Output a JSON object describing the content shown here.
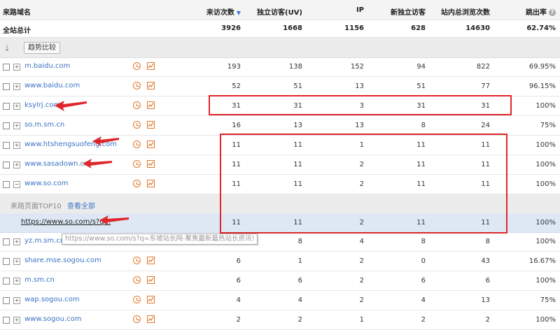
{
  "header": {
    "source_domain": "来路域名",
    "visits": "来访次数",
    "sort_arrow": "▼",
    "uv": "独立访客(UV)",
    "ip": "IP",
    "new_visitors": "新独立访客",
    "pageviews": "站内总浏览次数",
    "bounce_rate": "跳出率"
  },
  "total": {
    "label": "全站总计",
    "visits": "3926",
    "uv": "1668",
    "ip": "1156",
    "new_visitors": "628",
    "pageviews": "14630",
    "bounce_rate": "62.74%"
  },
  "trend_button": "趋势比较",
  "rows_top": [
    {
      "domain": "m.baidu.com",
      "expand": "+",
      "visits": "193",
      "uv": "138",
      "ip": "152",
      "new_visitors": "94",
      "pageviews": "822",
      "bounce_rate": "69.95%"
    },
    {
      "domain": "www.baidu.com",
      "expand": "+",
      "visits": "52",
      "uv": "51",
      "ip": "13",
      "new_visitors": "51",
      "pageviews": "77",
      "bounce_rate": "96.15%"
    },
    {
      "domain": "ksylrj.com",
      "expand": "+",
      "visits": "31",
      "uv": "31",
      "ip": "3",
      "new_visitors": "31",
      "pageviews": "31",
      "bounce_rate": "100%"
    },
    {
      "domain": "so.m.sm.cn",
      "expand": "+",
      "visits": "16",
      "uv": "13",
      "ip": "13",
      "new_visitors": "8",
      "pageviews": "24",
      "bounce_rate": "75%"
    },
    {
      "domain": "www.htshengsuofeng.com",
      "expand": "+",
      "visits": "11",
      "uv": "11",
      "ip": "1",
      "new_visitors": "11",
      "pageviews": "11",
      "bounce_rate": "100%"
    },
    {
      "domain": "www.sasadown.cn",
      "expand": "+",
      "visits": "11",
      "uv": "11",
      "ip": "2",
      "new_visitors": "11",
      "pageviews": "11",
      "bounce_rate": "100%"
    },
    {
      "domain": "www.so.com",
      "expand": "−",
      "visits": "11",
      "uv": "11",
      "ip": "2",
      "new_visitors": "11",
      "pageviews": "11",
      "bounce_rate": "100%"
    }
  ],
  "subheader": {
    "label": "来路页面TOP10",
    "view_all": "查看全部"
  },
  "url_row": {
    "url": "https://www.so.com/s?q...",
    "visits": "11",
    "uv": "11",
    "ip": "2",
    "new_visitors": "11",
    "pageviews": "11",
    "bounce_rate": "100%"
  },
  "tooltip": "https://www.so.com/s?q=东坡站长网-聚焦最新最热站长资讯!",
  "rows_bottom": [
    {
      "domain": "yz.m.sm.cn",
      "expand": "+",
      "visits": "8",
      "uv": "8",
      "ip": "4",
      "new_visitors": "8",
      "pageviews": "8",
      "bounce_rate": "100%"
    },
    {
      "domain": "share.mse.sogou.com",
      "expand": "+",
      "visits": "6",
      "uv": "1",
      "ip": "2",
      "new_visitors": "0",
      "pageviews": "43",
      "bounce_rate": "16.67%"
    },
    {
      "domain": "m.sm.cn",
      "expand": "+",
      "visits": "6",
      "uv": "6",
      "ip": "2",
      "new_visitors": "6",
      "pageviews": "6",
      "bounce_rate": "100%"
    },
    {
      "domain": "wap.sogou.com",
      "expand": "+",
      "visits": "4",
      "uv": "4",
      "ip": "2",
      "new_visitors": "4",
      "pageviews": "13",
      "bounce_rate": "75%"
    },
    {
      "domain": "www.sogou.com",
      "expand": "+",
      "visits": "2",
      "uv": "2",
      "ip": "1",
      "new_visitors": "2",
      "pageviews": "2",
      "bounce_rate": "100%"
    }
  ],
  "colors": {
    "link": "#3b74c4",
    "annotation": "#e0262b",
    "icon": "#e2782a"
  }
}
